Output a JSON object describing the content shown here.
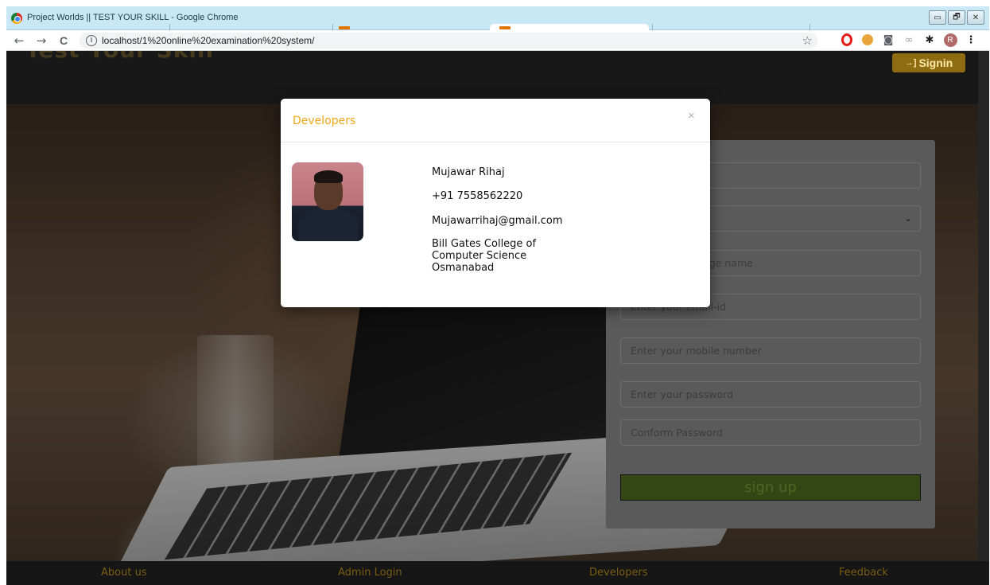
{
  "window": {
    "title": "Project Worlds || TEST YOUR SKILL - Google Chrome",
    "controls": [
      "▭",
      "🗗",
      "✕"
    ]
  },
  "browser": {
    "url": "localhost/1%20online%20examination%20system/",
    "nav": {
      "back": "←",
      "forward": "→",
      "reload": "C"
    }
  },
  "header": {
    "logo": "Test Your Skill",
    "signin_label": "Signin",
    "signin_icon": "→]"
  },
  "signup_form": {
    "fields": [
      {
        "placeholder": ""
      },
      {
        "placeholder": "",
        "type": "select"
      },
      {
        "placeholder": "Enter your college name"
      },
      {
        "placeholder": "Enter your email-id"
      },
      {
        "placeholder": "Enter your mobile number"
      },
      {
        "placeholder": "Enter your password"
      },
      {
        "placeholder": "Conform Password"
      }
    ],
    "submit_label": "sign up"
  },
  "modal": {
    "title": "Developers",
    "close": "×",
    "developer": {
      "name": "Mujawar Rihaj",
      "phone": "+91 7558562220",
      "email": "Mujawarrihaj@gmail.com",
      "college": "Bill Gates College of Computer Science Osmanabad"
    }
  },
  "footer": {
    "links": [
      "About us",
      "Admin Login",
      "Developers",
      "Feedback"
    ]
  },
  "colors": {
    "accent": "#f0a818",
    "signin_bg": "#8e6d12",
    "signup_bg": "#4f6d1f",
    "titlebar": "#c9e7f4"
  },
  "extension_icons": [
    "opera-icon",
    "cookie-icon",
    "camera-icon",
    "extension-icon",
    "puzzle-icon",
    "profile-avatar"
  ],
  "profile_initial": "R"
}
